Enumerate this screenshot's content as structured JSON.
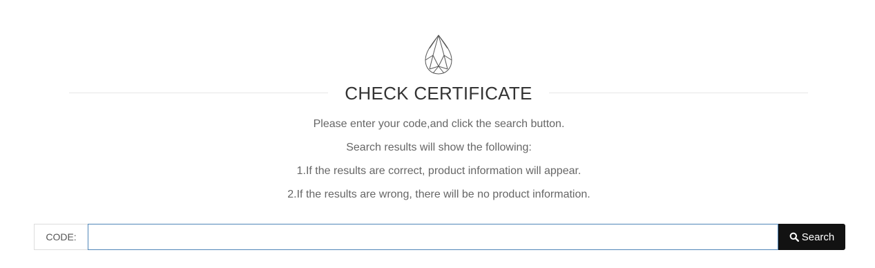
{
  "header": {
    "icon": "pear-diamond-icon",
    "title": "CHECK CERTIFICATE"
  },
  "instructions": [
    "Please enter your code,and click the search button.",
    "Search results will show the following:",
    "1.If the results are correct, product information will appear.",
    "2.If the results are wrong, there will be no product information."
  ],
  "search": {
    "label": "CODE:",
    "value": "",
    "button_label": "Search",
    "button_icon": "search-icon"
  },
  "colors": {
    "button_background": "#121212",
    "input_border": "#4f86b8",
    "title_text": "#333333",
    "instruction_text": "#666666"
  }
}
